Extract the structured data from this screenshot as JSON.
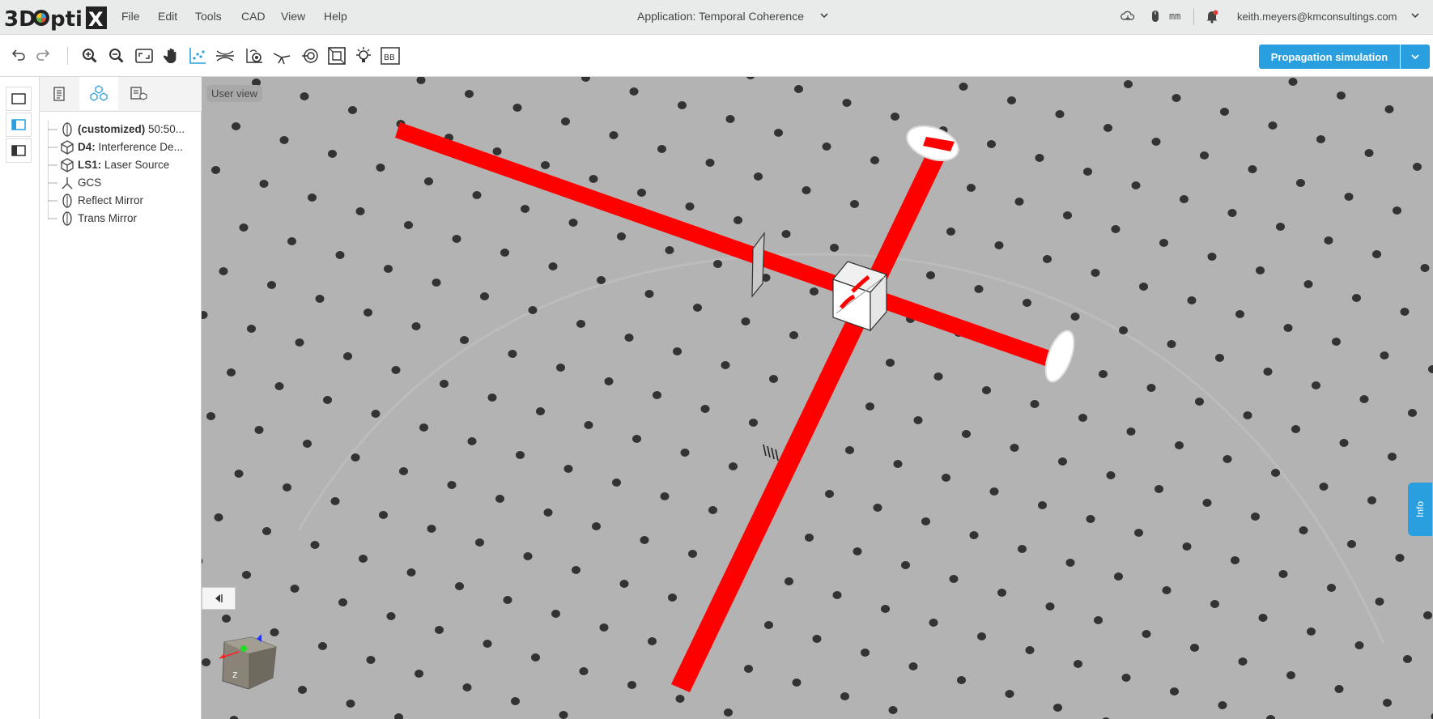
{
  "app": {
    "logo_text": "3DOptiX",
    "title": "Application: Temporal Coherence",
    "units": "mm",
    "user_email": "keith.meyers@kmconsultings.com"
  },
  "menu": [
    "File",
    "Edit",
    "Tools",
    "CAD",
    "View",
    "Help"
  ],
  "toolbar": {
    "tools": [
      "undo-icon",
      "redo-icon",
      "zoom-in-icon",
      "zoom-out-icon",
      "fit-view-icon",
      "pan-icon",
      "scatter-tool-icon",
      "focus-tool-icon",
      "camera-tool-icon",
      "ray-tool-icon",
      "spiral-tool-icon",
      "frame-tool-icon",
      "light-icon",
      "bounding-box-icon"
    ],
    "bb_label": "BB",
    "primary_action": "Propagation simulation"
  },
  "tree": {
    "items": [
      {
        "bold": "(customized)",
        "text": " 50:50...",
        "icon": "lens-icon"
      },
      {
        "bold": "D4:",
        "text": " Interference De...",
        "icon": "cube-icon"
      },
      {
        "bold": "LS1:",
        "text": " Laser Source",
        "icon": "cube-icon"
      },
      {
        "bold": "",
        "text": "GCS",
        "icon": "axes-icon"
      },
      {
        "bold": "",
        "text": "Reflect Mirror",
        "icon": "lens-icon"
      },
      {
        "bold": "",
        "text": "Trans Mirror",
        "icon": "lens-icon"
      }
    ]
  },
  "viewport": {
    "view_label": "User view",
    "info_tab": "Info",
    "background": "#b3b3b3",
    "beam_color": "#ff0000",
    "hole_color": "#333333"
  },
  "colors": {
    "accent": "#2a9fe0",
    "menubar": "#e9eaea"
  }
}
